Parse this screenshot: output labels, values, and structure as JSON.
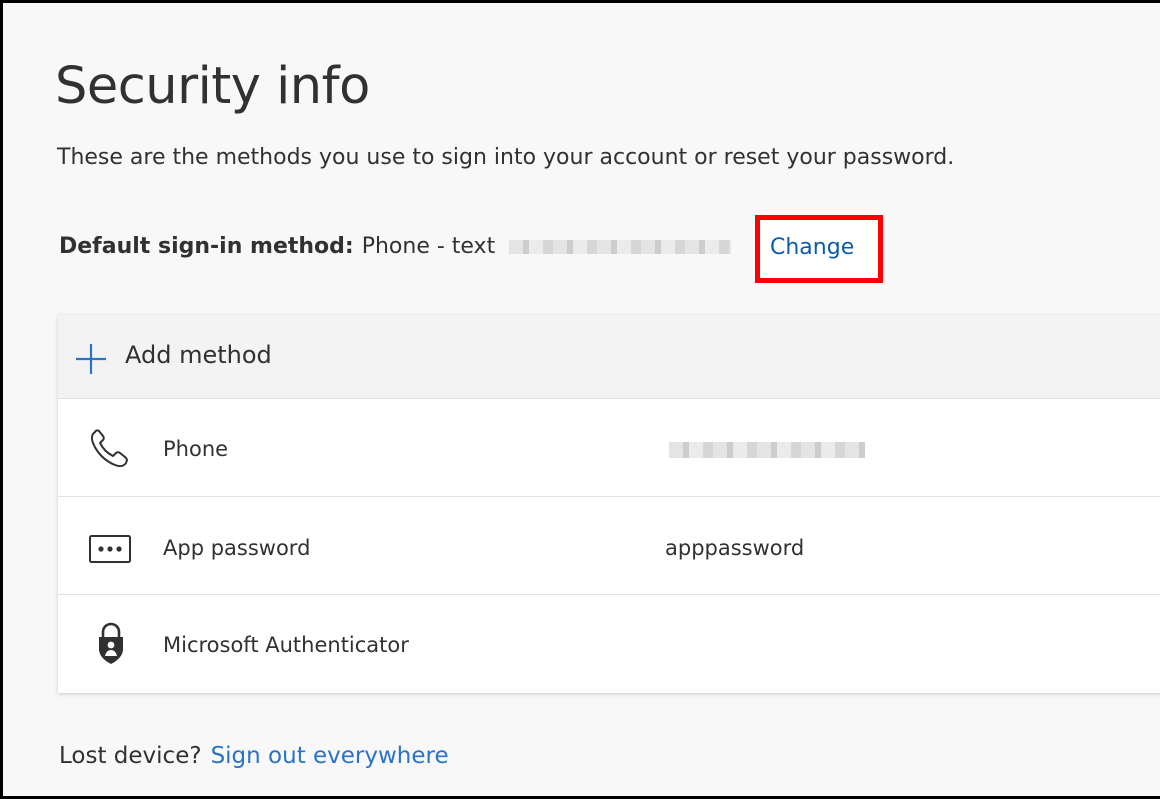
{
  "page": {
    "title": "Security info",
    "description": "These are the methods you use to sign into your account or reset your password."
  },
  "default_method": {
    "label": "Default sign-in method:",
    "value": "Phone - text",
    "change_label": "Change"
  },
  "methods": {
    "add_label": "Add method",
    "items": [
      {
        "name": "Phone",
        "detail": "",
        "icon": "phone-icon"
      },
      {
        "name": "App password",
        "detail": "apppassword",
        "icon": "app-password-icon"
      },
      {
        "name": "Microsoft Authenticator",
        "detail": "",
        "icon": "authenticator-lock-icon"
      }
    ]
  },
  "footer": {
    "lost_device_text": "Lost device?",
    "sign_out_label": "Sign out everywhere"
  },
  "colors": {
    "link": "#0f5ba7",
    "highlight_border": "#ff0000",
    "accent": "#2a73c5"
  }
}
